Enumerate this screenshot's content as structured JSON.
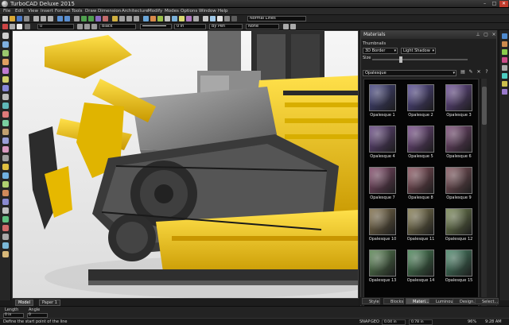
{
  "app": {
    "title": "TurboCAD Deluxe 2015",
    "window_controls": [
      "–",
      "□",
      "✕"
    ]
  },
  "menu": [
    "File",
    "Edit",
    "View",
    "Insert",
    "Format",
    "Tools",
    "Draw",
    "Dimension",
    "Architecture",
    "Modify",
    "Modes",
    "Options",
    "Window",
    "Help"
  ],
  "toolbar_top": {
    "render_mode": "Normal Lines"
  },
  "properties_bar": {
    "layer_value": "0",
    "color_value": "Black",
    "line_width_value": "0 in",
    "line_style_value": "By Pen",
    "fill_value": "None"
  },
  "materials_panel": {
    "title": "Materials",
    "view_mode": "Thumbnails",
    "border_option": "3D Border",
    "shadow_option": "Light Shadow",
    "size_label": "Size",
    "category": "Opalesque",
    "swatches": [
      {
        "label": "Opalesque 1",
        "color": "#4a4a86"
      },
      {
        "label": "Opalesque 2",
        "color": "#5a4e96"
      },
      {
        "label": "Opalesque 3",
        "color": "#6e4f97"
      },
      {
        "label": "Opalesque 4",
        "color": "#6a4a86"
      },
      {
        "label": "Opalesque 5",
        "color": "#7a4e8c"
      },
      {
        "label": "Opalesque 6",
        "color": "#7c4c78"
      },
      {
        "label": "Opalesque 7",
        "color": "#874e6e"
      },
      {
        "label": "Opalesque 8",
        "color": "#8e5662"
      },
      {
        "label": "Opalesque 9",
        "color": "#875a62"
      },
      {
        "label": "Opalesque 10",
        "color": "#857450"
      },
      {
        "label": "Opalesque 11",
        "color": "#8a8156"
      },
      {
        "label": "Opalesque 12",
        "color": "#7a8a56"
      },
      {
        "label": "Opalesque 13",
        "color": "#5e8a58"
      },
      {
        "label": "Opalesque 14",
        "color": "#4e8a5c"
      },
      {
        "label": "Opalesque 15",
        "color": "#4c8a6c"
      }
    ]
  },
  "panel_tabs": [
    "Style",
    "Blocks",
    "Materi...",
    "Luminous",
    "Design...",
    "Select..."
  ],
  "doc_tabs": [
    "Model",
    "Paper 1"
  ],
  "inspector": {
    "length_label": "Length",
    "angle_label": "Angle",
    "length_value": "0 in",
    "angle_value": "0"
  },
  "status": {
    "prompt": "Define the start point of the line",
    "snap": "SNAP",
    "geo": "GEO",
    "x_value": "0.04 in",
    "y_value": "0.78 in",
    "zoom": "96%",
    "time": "9:28 AM"
  },
  "colors": {
    "machine_yellow": "#f2c500",
    "track_dark": "#2e2e2e",
    "cab_gray": "#8a8a8a"
  }
}
